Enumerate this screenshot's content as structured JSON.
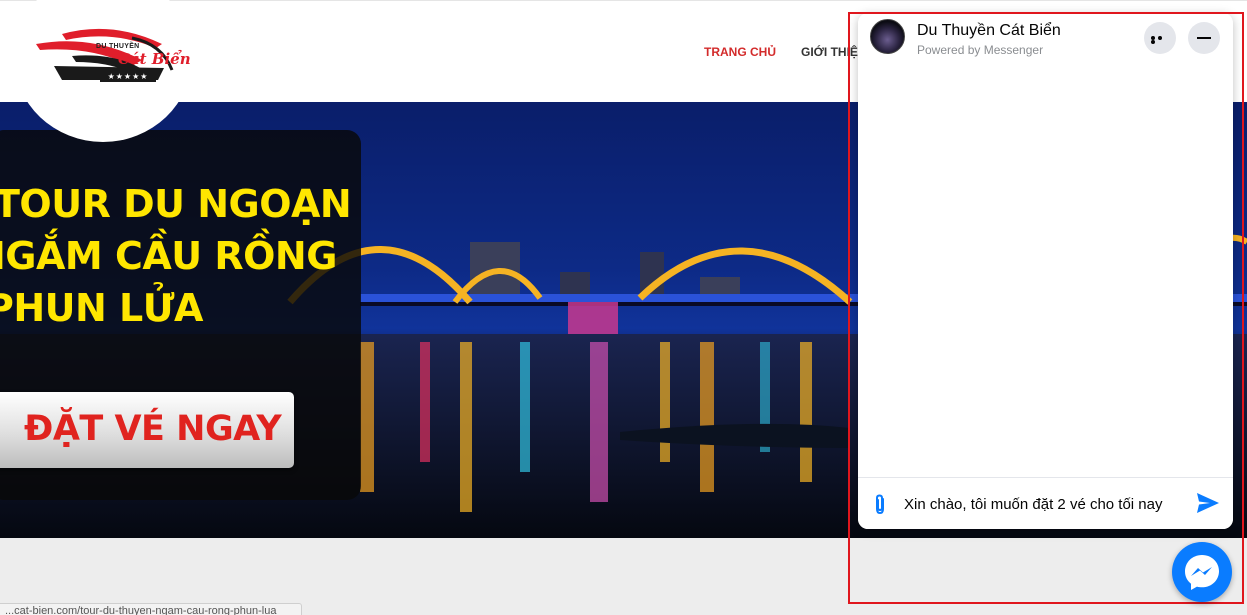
{
  "site": {
    "logo": {
      "top_text": "DU THUYỀN",
      "name": "Cát Biển",
      "stars": "★★★★★"
    },
    "nav": {
      "home": "TRANG CHỦ",
      "about": "GIỚI THIỆU"
    }
  },
  "hero": {
    "headline": [
      "TOUR DU NGOẠN",
      "NGẮM CẦU RỒNG",
      "PHUN LỬA"
    ],
    "book_button": "ĐẶT VÉ NGAY"
  },
  "status_bar": {
    "url": "...cat-bien.com/tour-du-thuyen-ngam-cau-rong-phun-lua"
  },
  "messenger": {
    "page_name": "Du Thuyền Cát Biển",
    "powered_by": "Powered by Messenger",
    "message_input_value": "Xin chào, tôi muốn đặt 2 vé cho tối nay",
    "icons": {
      "more": "more-horizontal-icon",
      "minimize": "minimize-icon",
      "attach": "paperclip-icon",
      "send": "send-icon",
      "launcher": "messenger-icon"
    },
    "accent_color": "#0a7cff"
  },
  "colors": {
    "nav_active": "#d32b2b",
    "headline": "#ffe600",
    "button_text": "#e0231f",
    "highlight_box": "#e0161d"
  }
}
